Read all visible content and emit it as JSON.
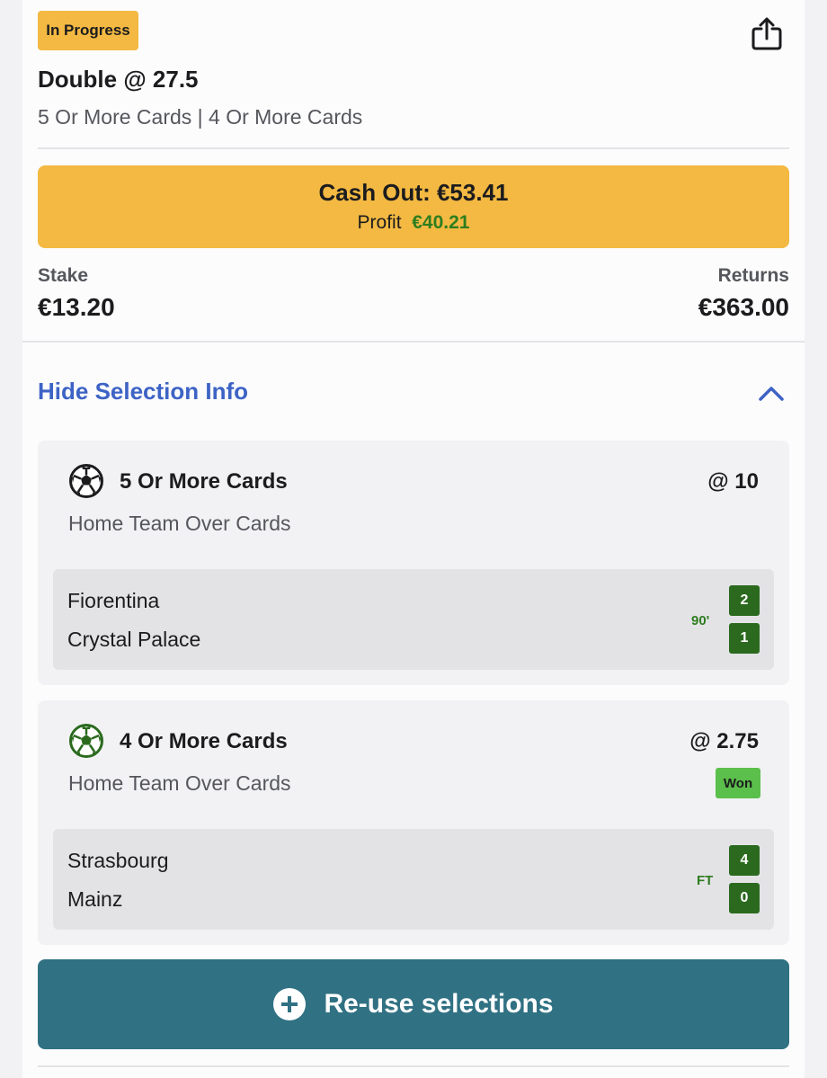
{
  "bet": {
    "status": "In Progress",
    "title": "Double @ 27.5",
    "subtitle": "5 Or More Cards | 4 Or More Cards",
    "share_icon": "share-icon"
  },
  "cash_out": {
    "label": "Cash Out: €53.41",
    "profit_label": "Profit",
    "profit_value": "€40.21"
  },
  "stake": {
    "label": "Stake",
    "value": "€13.20"
  },
  "returns": {
    "label": "Returns",
    "value": "€363.00"
  },
  "selection_toggle": {
    "label": "Hide Selection Info",
    "icon": "chevron-up-icon"
  },
  "selections": [
    {
      "title": "5 Or More Cards",
      "odds": "@ 10",
      "market": "Home Team Over Cards",
      "icon": "soccer-ball-icon",
      "icon_color": "#1c1c1e",
      "result": "",
      "match": {
        "home": "Fiorentina",
        "away": "Crystal Palace",
        "clock": "90'",
        "home_score": "2",
        "away_score": "1"
      }
    },
    {
      "title": "4 Or More Cards",
      "odds": "@ 2.75",
      "market": "Home Team Over Cards",
      "icon": "soccer-ball-icon",
      "icon_color": "#2b6a1e",
      "result": "Won",
      "match": {
        "home": "Strasbourg",
        "away": "Mainz",
        "clock": "FT",
        "home_score": "4",
        "away_score": "0"
      }
    }
  ],
  "reuse_button": {
    "label": "Re-use selections",
    "icon": "plus-circle-icon"
  },
  "colors": {
    "accent_yellow": "#f3b942",
    "link_blue": "#3d63c5",
    "profit_green": "#2e7d1f",
    "score_green": "#2b6a1e",
    "won_green": "#5bbf4b",
    "reuse_teal": "#307183"
  }
}
